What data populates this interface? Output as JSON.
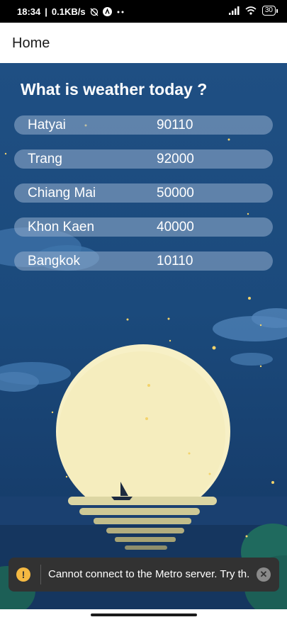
{
  "status_bar": {
    "time": "18:34",
    "network_speed": "0.1KB/s",
    "battery": "30",
    "icons": [
      "alarm-off-icon",
      "app-notification-icon",
      "more-dots-icon",
      "signal-icon",
      "wifi-icon",
      "battery-icon"
    ]
  },
  "header": {
    "title": "Home"
  },
  "main": {
    "title": "What is weather today ?",
    "cities": [
      {
        "name": "Hatyai",
        "code": "90110"
      },
      {
        "name": "Trang",
        "code": "92000"
      },
      {
        "name": "Chiang Mai",
        "code": "50000"
      },
      {
        "name": "Khon Kaen",
        "code": "40000"
      },
      {
        "name": "Bangkok",
        "code": "10110"
      }
    ]
  },
  "toast": {
    "message": "Cannot connect to the Metro server.  Try th...",
    "icon": "warning-icon",
    "close_icon": "close-icon",
    "warn_symbol": "!",
    "close_symbol": "✕"
  },
  "colors": {
    "sky": "#1f4f83",
    "moon": "#f7f0c6",
    "row_bg": "#96afcd",
    "toast_bg": "#323232"
  }
}
